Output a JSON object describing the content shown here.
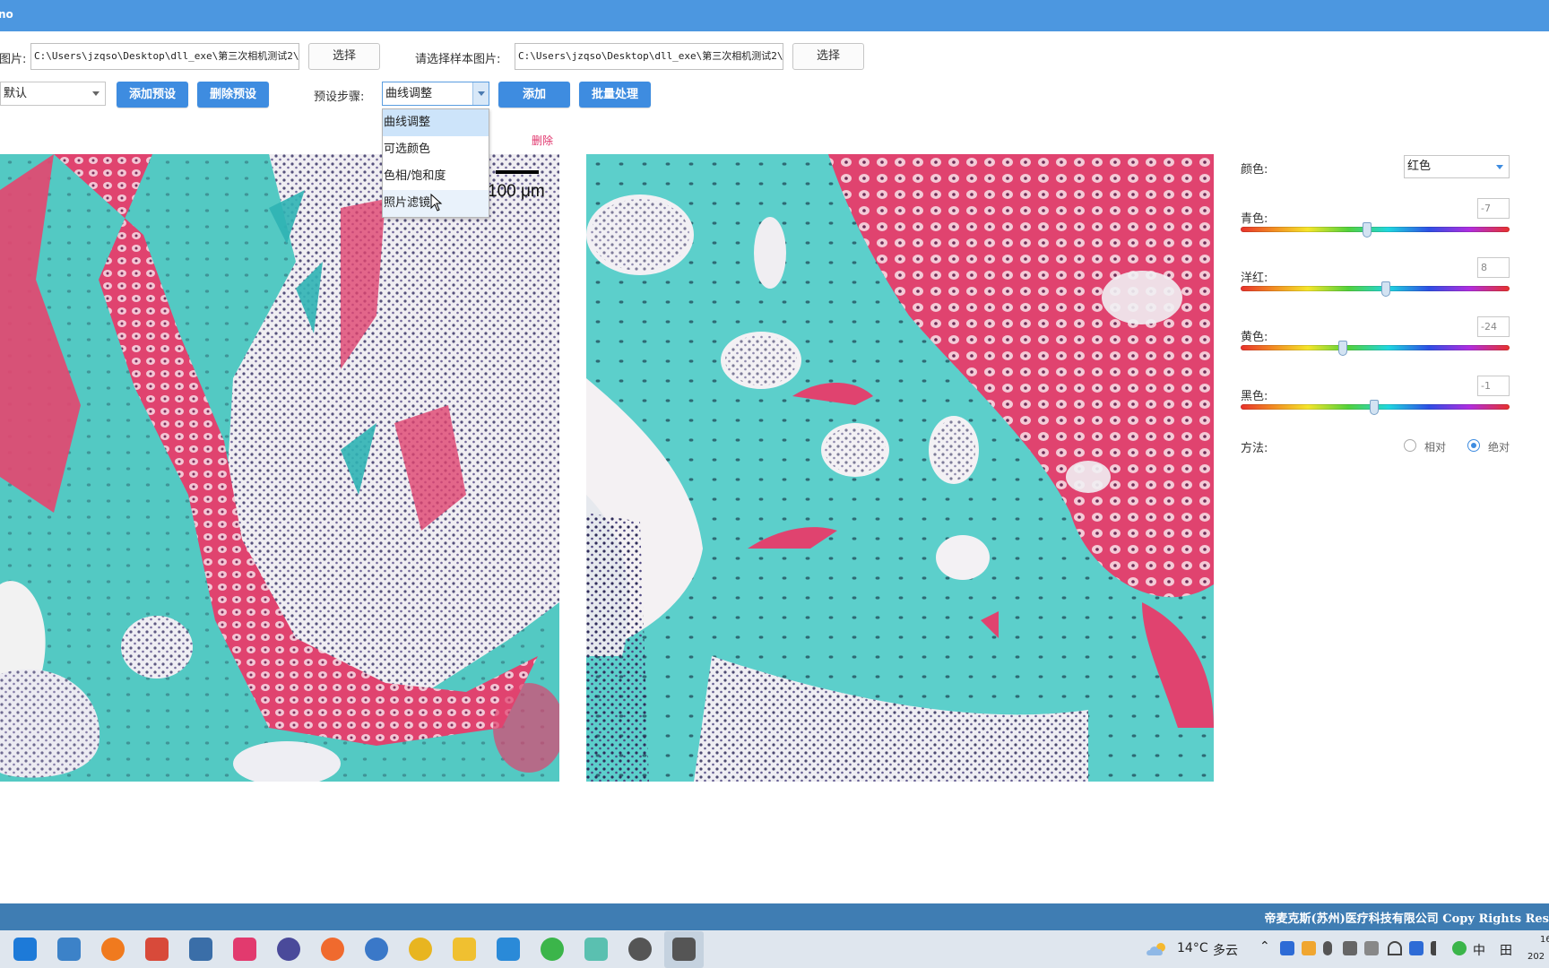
{
  "window": {
    "title": "no"
  },
  "row1": {
    "source_label": "图片:",
    "source_path": "C:\\Users\\jzqso\\Desktop\\dll_exe\\第三次相机测试2\\番",
    "source_select_button": "选择",
    "sample_label": "请选择样本图片:",
    "sample_path": "C:\\Users\\jzqso\\Desktop\\dll_exe\\第三次相机测试2\\番",
    "sample_select_button": "选择"
  },
  "row2": {
    "preset_value": "默认",
    "add_preset_button": "添加预设",
    "delete_preset_button": "删除预设",
    "step_label": "预设步骤:",
    "step_value": "曲线调整",
    "add_button": "添加",
    "batch_button": "批量处理"
  },
  "step_dropdown": {
    "options": [
      "曲线调整",
      "可选颜色",
      "色相/饱和度",
      "照片滤镜"
    ],
    "selected_index": 0,
    "hovered_index": 3
  },
  "delete_link": "删除",
  "image_left": {
    "scale_label": "100 μm"
  },
  "panel": {
    "color_label": "颜色:",
    "color_value": "红色",
    "sliders": [
      {
        "label": "青色:",
        "value": "-7",
        "level": 0.47
      },
      {
        "label": "洋红:",
        "value": "8",
        "level": 0.54
      },
      {
        "label": "黄色:",
        "value": "-24",
        "level": 0.38
      },
      {
        "label": "黑色:",
        "value": "-1",
        "level": 0.495
      }
    ],
    "method_label": "方法:",
    "method_options": [
      "相对",
      "绝对"
    ],
    "method_selected": "绝对"
  },
  "footer": {
    "copyright": "帝麦克斯(苏州)医疗科技有限公司 Copy Rights Res"
  },
  "taskbar": {
    "icons": [
      "mail-icon",
      "laptop-icon",
      "firefox-icon",
      "paint-icon",
      "remote-desktop-icon",
      "jetbrains-icon",
      "obs-icon",
      "pen-icon",
      "qbittorrent-icon",
      "chrome-icon",
      "folder-icon",
      "edge-dev-icon",
      "wechat-icon",
      "notepad-icon",
      "aperture-icon",
      "clipboard-app-icon"
    ],
    "weather_temp": "14°C",
    "weather_desc": "多云",
    "ime_lang": "中",
    "ime_mode": "田",
    "clock_time": "16",
    "clock_date": "202"
  },
  "colors": {
    "titlebar": "#4c97e0",
    "button_blue": "#3e8ce0",
    "footer": "#3f7db3",
    "delete_link": "#e0336b"
  }
}
